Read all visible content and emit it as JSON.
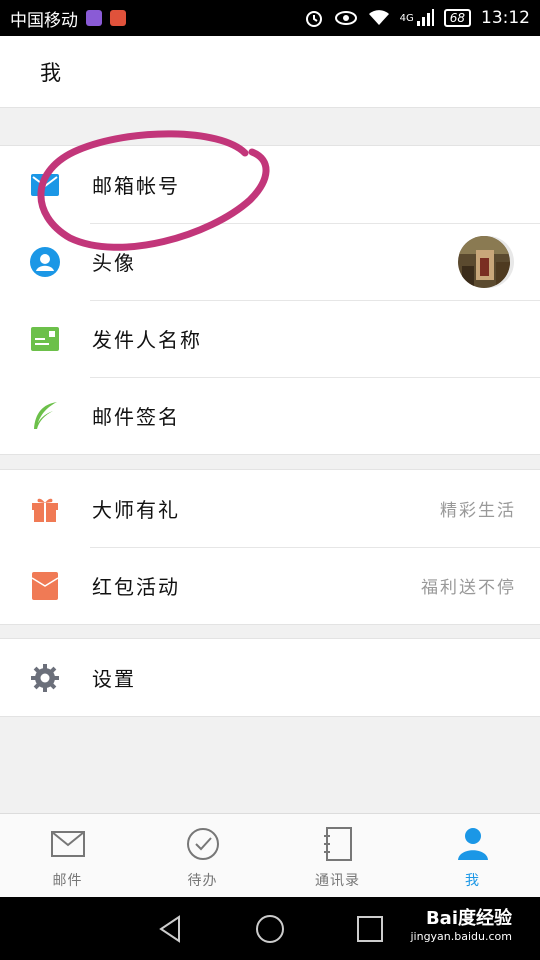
{
  "status_bar": {
    "carrier": "中国移动",
    "network": "4G",
    "battery": "68",
    "time": "13:12"
  },
  "header": {
    "title": "我"
  },
  "groups": [
    {
      "rows": [
        {
          "name": "account",
          "label": "邮箱帐号",
          "icon": "mail-icon",
          "icon_color": "#1b97e6"
        },
        {
          "name": "avatar",
          "label": "头像",
          "icon": "user-icon",
          "icon_color": "#1b97e6"
        },
        {
          "name": "sender-name",
          "label": "发件人名称",
          "icon": "id-card-icon",
          "icon_color": "#6cc04a"
        },
        {
          "name": "signature",
          "label": "邮件签名",
          "icon": "feather-icon",
          "icon_color": "#6cc04a"
        }
      ]
    },
    {
      "rows": [
        {
          "name": "gift",
          "label": "大师有礼",
          "right_text": "精彩生活",
          "icon": "gift-icon",
          "icon_color": "#f07a55"
        },
        {
          "name": "red-packet",
          "label": "红包活动",
          "right_text": "福利送不停",
          "icon": "red-envelope-icon",
          "icon_color": "#f07a55"
        }
      ]
    },
    {
      "rows": [
        {
          "name": "settings",
          "label": "设置",
          "icon": "gear-icon",
          "icon_color": "#6b6f7a"
        }
      ]
    }
  ],
  "tabs": [
    {
      "label": "邮件",
      "icon": "mail-outline-icon",
      "active": false
    },
    {
      "label": "待办",
      "icon": "check-circle-icon",
      "active": false
    },
    {
      "label": "通讯录",
      "icon": "contacts-icon",
      "active": false
    },
    {
      "label": "我",
      "icon": "person-icon",
      "active": true
    }
  ],
  "colors": {
    "accent": "#1b97e6",
    "annotation": "#c2367a"
  },
  "watermark": {
    "brand": "Bai度经验",
    "url": "jingyan.baidu.com"
  }
}
